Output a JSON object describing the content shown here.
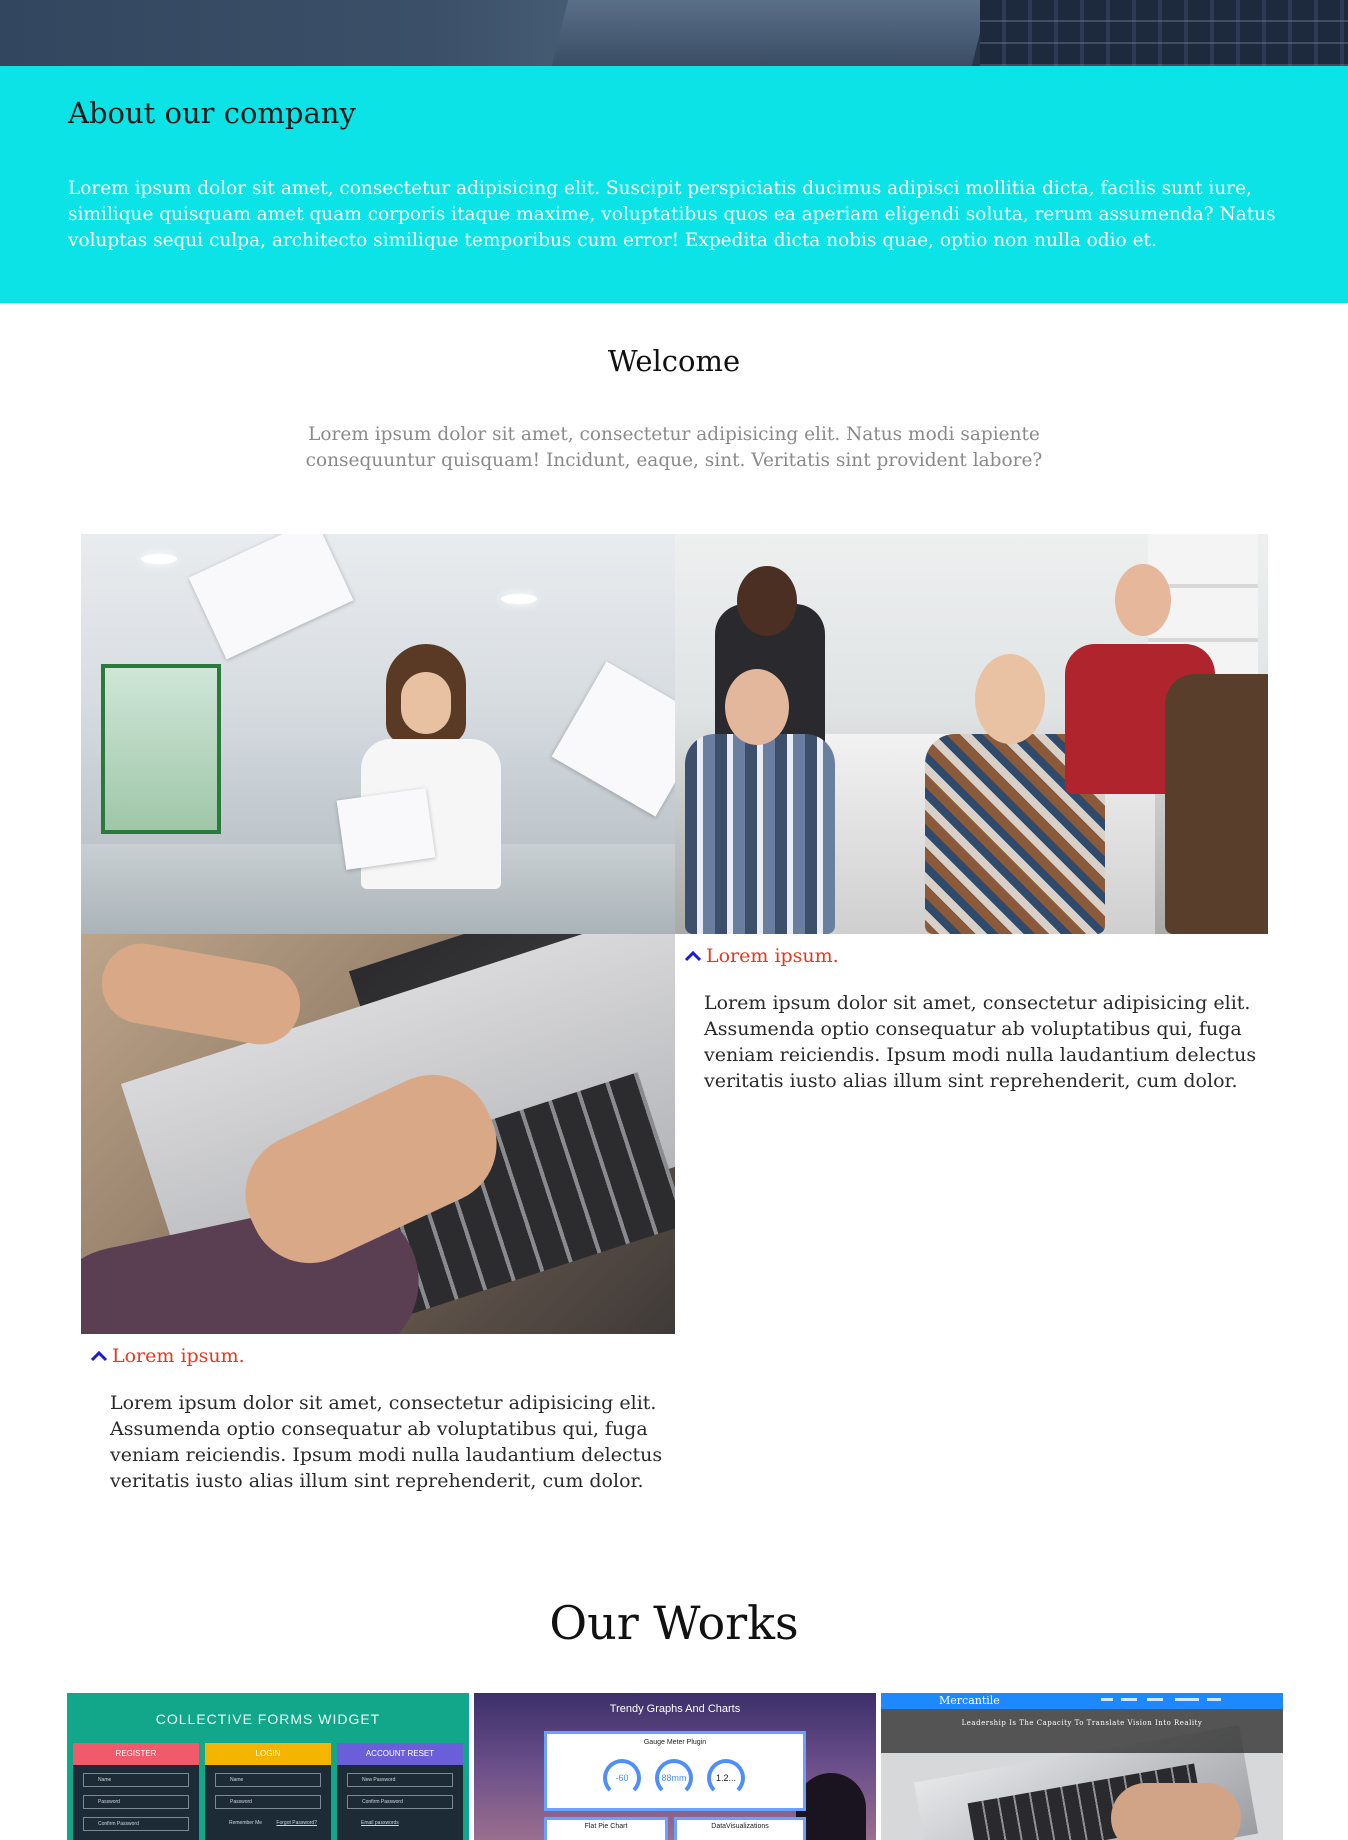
{
  "about": {
    "title": "About our company",
    "body": "Lorem ipsum dolor sit amet, consectetur adipisicing elit. Suscipit perspiciatis ducimus adipisci mollitia dicta, facilis sunt iure, similique quisquam amet quam corporis itaque maxime, voluptatibus quos ea aperiam eligendi soluta, rerum assumenda? Natus voluptas sequi culpa, architecto similique temporibus cum error! Expedita dicta nobis quae, optio non nulla odio et.",
    "bg_color": "#0be3e6"
  },
  "welcome": {
    "title": "Welcome",
    "body": "Lorem ipsum dolor sit amet, consectetur adipisicing elit. Natus modi sapiente consequuntur quisquam! Incidunt, eaque, sint. Veritatis sint provident labore?"
  },
  "features": [
    {
      "icon": "chevron-up-icon",
      "title": "Lorem ipsum.",
      "body": "Lorem ipsum dolor sit amet, consectetur adipisicing elit. Assumenda optio consequatur ab voluptatibus qui, fuga veniam reiciendis. Ipsum modi nulla laudantium delectus veritatis iusto alias illum sint reprehenderit, cum dolor."
    },
    {
      "icon": "chevron-up-icon",
      "title": "Lorem ipsum.",
      "body": "Lorem ipsum dolor sit amet, consectetur adipisicing elit. Assumenda optio consequatur ab voluptatibus qui, fuga veniam reiciendis. Ipsum modi nulla laudantium delectus veritatis iusto alias illum sint reprehenderit, cum dolor."
    }
  ],
  "colors": {
    "accent_red": "#e2391f",
    "chevron_blue": "#1a1adb"
  },
  "works": {
    "title": "Our Works",
    "items": [
      {
        "title": "COLLECTIVE FORMS WIDGET",
        "columns": [
          {
            "header": "REGISTER",
            "color": "#f05a6a",
            "fields": [
              "Name",
              "Password",
              "Confirm Password"
            ]
          },
          {
            "header": "LOGIN",
            "color": "#f5b400",
            "fields": [
              "Name",
              "Password",
              "Remember Me",
              "Forgot Password?"
            ]
          },
          {
            "header": "ACCOUNT RESET",
            "color": "#6a5fd8",
            "fields": [
              "New Password",
              "Confirm Password",
              "Email passwords"
            ]
          }
        ]
      },
      {
        "title": "Trendy Graphs And Charts",
        "card_title": "Gauge Meter Plugin",
        "gauges": [
          "-60",
          "88mm",
          "1.2..."
        ],
        "bottom_cards": [
          "Flat Pie Chart",
          "DataVisualizations"
        ]
      },
      {
        "brand": "Mercantile",
        "tagline": "Leadership Is The Capacity To Translate Vision Into Reality"
      }
    ]
  }
}
